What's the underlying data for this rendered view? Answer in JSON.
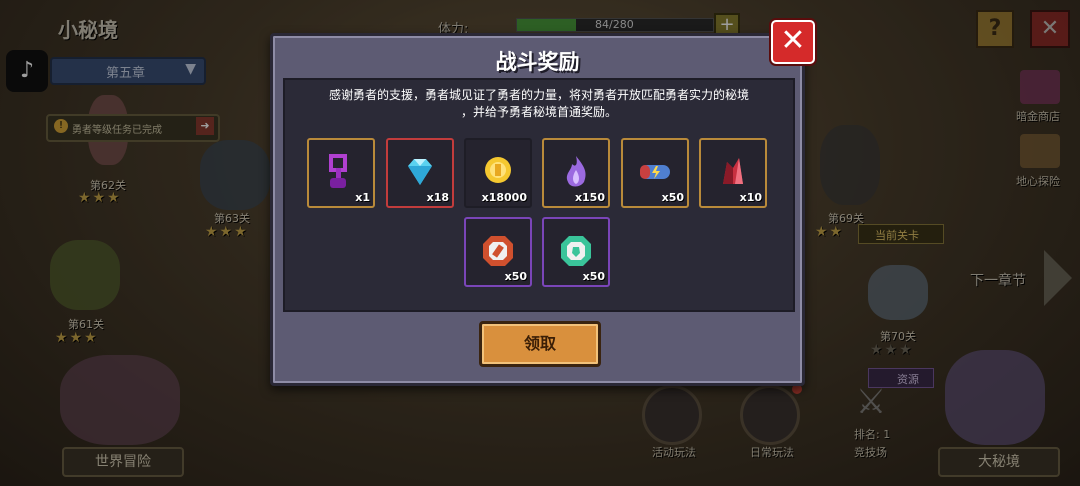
{
  "top_left": {
    "title": "小秘境",
    "chapter": "第五章",
    "quest_text": "勇者等级任务已完成"
  },
  "stamina": {
    "label": "体力:",
    "value": "84/280",
    "fraction": 0.3
  },
  "right_panel": {
    "shop_label": "暗金商店",
    "explore_label": "地心探险",
    "next_chapter": "下一章节"
  },
  "levels": {
    "l62": "第62关",
    "l63": "第63关",
    "l61": "第61关",
    "l69": "第69关",
    "l70": "第70关",
    "current": "当前关卡",
    "resource": "资源"
  },
  "bottom": {
    "world": "世界冒险",
    "activity": "活动玩法",
    "daily": "日常玩法",
    "rank": "排名: 1",
    "arena": "竞技场",
    "big_realm": "大秘境"
  },
  "modal": {
    "title": "战斗奖励",
    "close_glyph": "✕",
    "description_line1": "感谢勇者的支援，勇者城见证了勇者的力量，将对勇者开放匹配勇者实力的秘境",
    "description_line2": "，并给予勇者秘境首通奖励。",
    "claim_label": "领取",
    "rewards": [
      {
        "icon": "purple-key-icon",
        "qty": "x1",
        "color": "#b040d0"
      },
      {
        "icon": "diamond-icon",
        "qty": "x18",
        "color": "#5ad2f0"
      },
      {
        "icon": "gold-coin-icon",
        "qty": "x18000",
        "color": "#f5c830"
      },
      {
        "icon": "purple-flame-icon",
        "qty": "x150",
        "color": "#9b6ae0"
      },
      {
        "icon": "energy-capsule-icon",
        "qty": "x50",
        "color": "#4f7fd0"
      },
      {
        "icon": "red-crystal-icon",
        "qty": "x10",
        "color": "#c83040"
      },
      {
        "icon": "red-octagon-gem-icon",
        "qty": "x50",
        "color": "#d0502e"
      },
      {
        "icon": "green-octagon-gem-icon",
        "qty": "x50",
        "color": "#3ac49a"
      }
    ]
  }
}
